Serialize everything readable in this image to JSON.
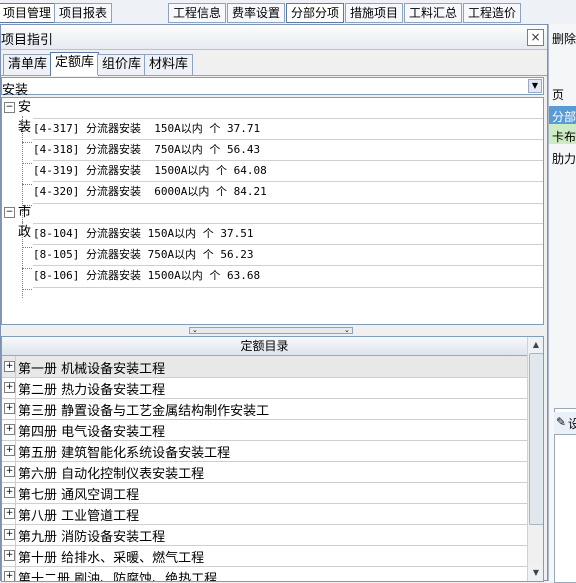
{
  "menubar": {
    "items": [
      {
        "label": "项目管理"
      },
      {
        "label": "项目报表"
      },
      {
        "label": "工程信息"
      },
      {
        "label": "费率设置"
      },
      {
        "label": "分部分项"
      },
      {
        "label": "措施项目"
      },
      {
        "label": "工料汇总"
      },
      {
        "label": "工程造价"
      }
    ]
  },
  "background": {
    "right_labels": [
      "删除行",
      "页",
      "分部.",
      "卡布纟",
      "肋力纟"
    ],
    "panel2_label": "设"
  },
  "dialog": {
    "title": "项目指引",
    "close_glyph": "×",
    "tabs": [
      {
        "label": "清单库"
      },
      {
        "label": "定额库"
      },
      {
        "label": "组价库"
      },
      {
        "label": "材料库"
      }
    ],
    "combo_value": "安装",
    "tree": {
      "groups": [
        {
          "label": "安装",
          "expander": "−",
          "items": [
            {
              "text": "[4-317] 分流器安装  150A以内 个 37.71"
            },
            {
              "text": "[4-318] 分流器安装  750A以内 个 56.43"
            },
            {
              "text": "[4-319] 分流器安装  1500A以内 个 64.08"
            },
            {
              "text": "[4-320] 分流器安装  6000A以内 个 84.21"
            }
          ]
        },
        {
          "label": "市政",
          "expander": "−",
          "items": [
            {
              "text": "[8-104] 分流器安装 150A以内 个 37.51"
            },
            {
              "text": "[8-105] 分流器安装 750A以内 个 56.23"
            },
            {
              "text": "[8-106] 分流器安装 1500A以内 个 63.68"
            }
          ]
        }
      ]
    },
    "splitter_glyphs": "⌄⋯⌄",
    "catalog": {
      "header": "定额目录",
      "expander": "+",
      "rows": [
        {
          "label": "第一册 机械设备安装工程"
        },
        {
          "label": "第二册 热力设备安装工程"
        },
        {
          "label": "第三册 静置设备与工艺金属结构制作安装工"
        },
        {
          "label": "第四册 电气设备安装工程"
        },
        {
          "label": "第五册 建筑智能化系统设备安装工程"
        },
        {
          "label": "第六册 自动化控制仪表安装工程"
        },
        {
          "label": "第七册 通风空调工程"
        },
        {
          "label": "第八册 工业管道工程"
        },
        {
          "label": "第九册 消防设备安装工程"
        },
        {
          "label": "第十册 给排水、采暖、燃气工程"
        },
        {
          "label": "第十二册 刷油、防腐蚀、绝热工程"
        }
      ],
      "scroll_up_glyph": "▲",
      "scroll_down_glyph": "▼"
    }
  },
  "colors": {
    "accent_border": "#7f9db9",
    "selected_row": "#e8e8e8",
    "active_tab": "#ffffff",
    "green_cell": "#cdecc4",
    "blue_cell": "#5b9bd5"
  }
}
